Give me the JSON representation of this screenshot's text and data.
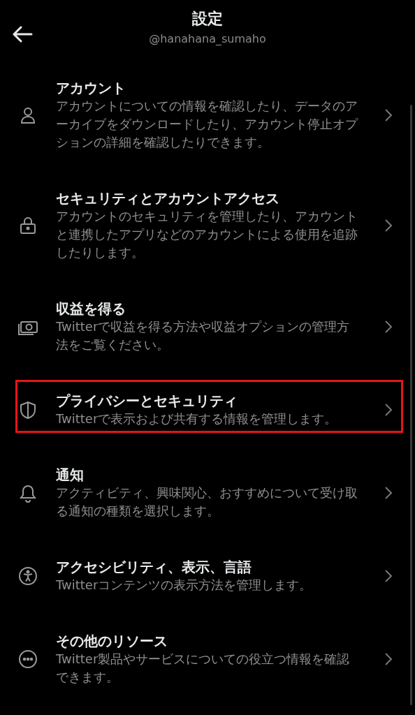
{
  "header": {
    "title": "設定",
    "handle": "@hanahana_sumaho"
  },
  "items": [
    {
      "kind": "person",
      "title": "アカウント",
      "description": "アカウントについての情報を確認したり、データのアーカイブをダウンロードしたり、アカウント停止オプションの詳細を確認したりできます。",
      "highlighted": false
    },
    {
      "kind": "lock",
      "title": "セキュリティとアカウントアクセス",
      "description": "アカウントのセキュリティを管理したり、アカウントと連携したアプリなどのアカウントによる使用を追跡したりします。",
      "highlighted": false
    },
    {
      "kind": "money",
      "title": "収益を得る",
      "description": "Twitterで収益を得る方法や収益オプションの管理方法をご覧ください。",
      "highlighted": false
    },
    {
      "kind": "shield",
      "title": "プライバシーとセキュリティ",
      "description": "Twitterで表示および共有する情報を管理します。",
      "highlighted": true
    },
    {
      "kind": "bell",
      "title": "通知",
      "description": "アクティビティ、興味関心、おすすめについて受け取る通知の種類を選択します。",
      "highlighted": false
    },
    {
      "kind": "accessibility",
      "title": "アクセシビリティ、表示、言語",
      "description": "Twitterコンテンツの表示方法を管理します。",
      "highlighted": false
    },
    {
      "kind": "more",
      "title": "その他のリソース",
      "description": "Twitter製品やサービスについての役立つ情報を確認できます。",
      "highlighted": false
    }
  ]
}
